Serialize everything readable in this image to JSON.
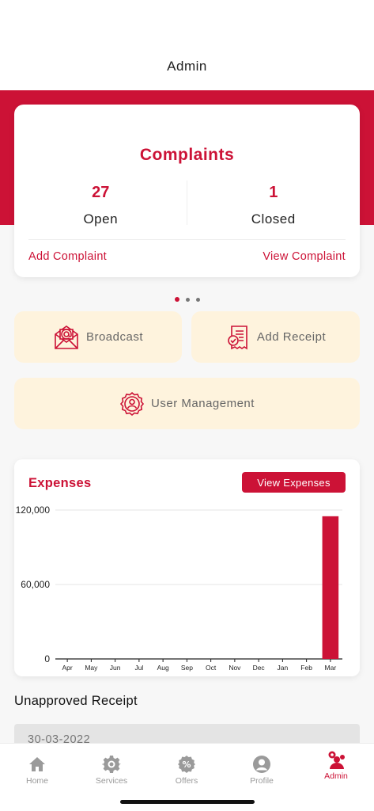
{
  "header": {
    "title": "Admin"
  },
  "complaints": {
    "title": "Complaints",
    "open_count": "27",
    "open_label": "Open",
    "closed_count": "1",
    "closed_label": "Closed",
    "add_link": "Add Complaint",
    "view_link": "View Complaint"
  },
  "carousel": {
    "pages": 3,
    "active": 0
  },
  "tiles": {
    "broadcast": "Broadcast",
    "add_receipt": "Add Receipt",
    "user_management": "User Management"
  },
  "expenses": {
    "title": "Expenses",
    "button": "View Expenses"
  },
  "chart_data": {
    "type": "bar",
    "categories": [
      "Apr",
      "May",
      "Jun",
      "Jul",
      "Aug",
      "Sep",
      "Oct",
      "Nov",
      "Dec",
      "Jan",
      "Feb",
      "Mar"
    ],
    "values": [
      0,
      0,
      0,
      0,
      0,
      0,
      0,
      0,
      0,
      0,
      0,
      115000
    ],
    "yticks": [
      "0",
      "60,000",
      "120,000"
    ],
    "ytick_values": [
      0,
      60000,
      120000
    ],
    "ylim": [
      0,
      120000
    ],
    "grid": true,
    "bar_color": "#cc1236"
  },
  "unapproved": {
    "title": "Unapproved Receipt",
    "items": [
      "30-03-2022"
    ]
  },
  "nav": {
    "items": [
      {
        "label": "Home",
        "icon": "home-icon"
      },
      {
        "label": "Services",
        "icon": "gear-icon"
      },
      {
        "label": "Offers",
        "icon": "percent-icon"
      },
      {
        "label": "Profile",
        "icon": "profile-icon"
      },
      {
        "label": "Admin",
        "icon": "admin-icon"
      }
    ],
    "active": 4
  },
  "colors": {
    "accent": "#cc1236",
    "tile_bg": "#fef3dd",
    "inactive": "#9a9a9a"
  }
}
